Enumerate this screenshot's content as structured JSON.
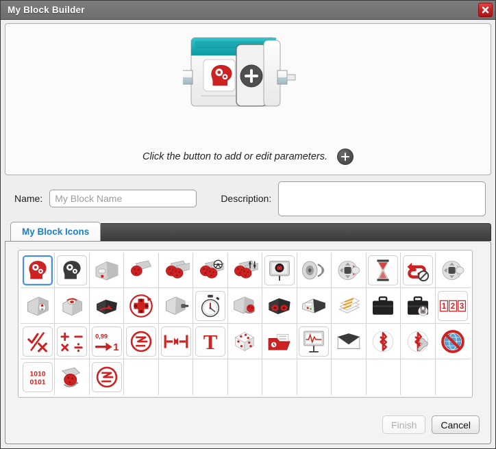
{
  "window": {
    "title": "My Block Builder",
    "close_icon": "close-x-icon"
  },
  "preview": {
    "block_icon": "head-with-gears-red-icon",
    "add_param_icon": "plus-circle-icon",
    "hint_text": "Click the button to add or edit parameters.",
    "hint_plus_icon": "plus-circle-icon"
  },
  "form": {
    "name_label": "Name:",
    "name_value": "",
    "name_placeholder": "My Block Name",
    "description_label": "Description:",
    "description_value": "",
    "description_placeholder": ""
  },
  "tabs": {
    "active": "My Block Icons",
    "items": [
      {
        "label": "My Block Icons",
        "selected": true
      }
    ]
  },
  "icon_grid": {
    "columns": 13,
    "rows": 4,
    "selected_index": 0,
    "icons": [
      {
        "name": "head-gears-red-icon",
        "boxed": true
      },
      {
        "name": "head-gears-black-icon",
        "boxed": true
      },
      {
        "name": "ev3-brick-icon",
        "boxed": false
      },
      {
        "name": "large-motor-icon",
        "boxed": false
      },
      {
        "name": "two-large-motors-icon",
        "boxed": false
      },
      {
        "name": "move-steering-icon",
        "boxed": false
      },
      {
        "name": "move-tank-icon",
        "boxed": false
      },
      {
        "name": "display-icon",
        "boxed": true
      },
      {
        "name": "speaker-sound-icon",
        "boxed": false
      },
      {
        "name": "brick-status-light-icon",
        "boxed": false
      },
      {
        "name": "wait-hourglass-icon",
        "boxed": true
      },
      {
        "name": "loop-interrupt-icon",
        "boxed": true
      },
      {
        "name": "brick-buttons-icon",
        "boxed": false
      },
      {
        "name": "color-sensor-icon",
        "boxed": false
      },
      {
        "name": "ultrasonic-sensor-icon",
        "boxed": false
      },
      {
        "name": "gyro-sensor-icon",
        "boxed": false
      },
      {
        "name": "infrared-beacon-icon",
        "boxed": false
      },
      {
        "name": "touch-sensor-icon",
        "boxed": false
      },
      {
        "name": "timer-stopwatch-icon",
        "boxed": true
      },
      {
        "name": "motor-rotation-icon",
        "boxed": false
      },
      {
        "name": "infrared-sensor-icon",
        "boxed": false
      },
      {
        "name": "energy-meter-icon",
        "boxed": false
      },
      {
        "name": "data-logging-icon",
        "boxed": false
      },
      {
        "name": "file-access-icon",
        "boxed": false
      },
      {
        "name": "file-access-locked-icon",
        "boxed": false
      },
      {
        "name": "numbers-123-icon",
        "boxed": true
      },
      {
        "name": "logic-check-cross-icon",
        "boxed": true
      },
      {
        "name": "math-operators-icon",
        "boxed": true
      },
      {
        "name": "round-number-icon",
        "boxed": true
      },
      {
        "name": "compare-icon",
        "boxed": true
      },
      {
        "name": "range-icon",
        "boxed": true
      },
      {
        "name": "text-t-icon",
        "boxed": true
      },
      {
        "name": "random-dice-icon",
        "boxed": false
      },
      {
        "name": "array-file-icon",
        "boxed": false
      },
      {
        "name": "data-graph-icon",
        "boxed": true
      },
      {
        "name": "messaging-envelope-icon",
        "boxed": false
      },
      {
        "name": "bluetooth-icon",
        "boxed": false
      },
      {
        "name": "bluetooth-settings-icon",
        "boxed": false
      },
      {
        "name": "no-internet-icon",
        "boxed": false
      },
      {
        "name": "binary-1010-0101-icon",
        "boxed": true
      },
      {
        "name": "unregulated-motor-icon",
        "boxed": false
      },
      {
        "name": "compare-alt-icon",
        "boxed": true
      },
      {
        "name": "",
        "boxed": false
      },
      {
        "name": "",
        "boxed": false
      },
      {
        "name": "",
        "boxed": false
      },
      {
        "name": "",
        "boxed": false
      },
      {
        "name": "",
        "boxed": false
      },
      {
        "name": "",
        "boxed": false
      },
      {
        "name": "",
        "boxed": false
      },
      {
        "name": "",
        "boxed": false
      },
      {
        "name": "",
        "boxed": false
      },
      {
        "name": "",
        "boxed": false
      }
    ]
  },
  "footer": {
    "finish_label": "Finish",
    "finish_enabled": false,
    "cancel_label": "Cancel",
    "cancel_enabled": true
  },
  "colors": {
    "titlebar": "#757575",
    "close_red": "#c72222",
    "tab_text_blue": "#1f7fc4",
    "block_teal": "#18b0b8",
    "icon_red": "#cc2222"
  }
}
